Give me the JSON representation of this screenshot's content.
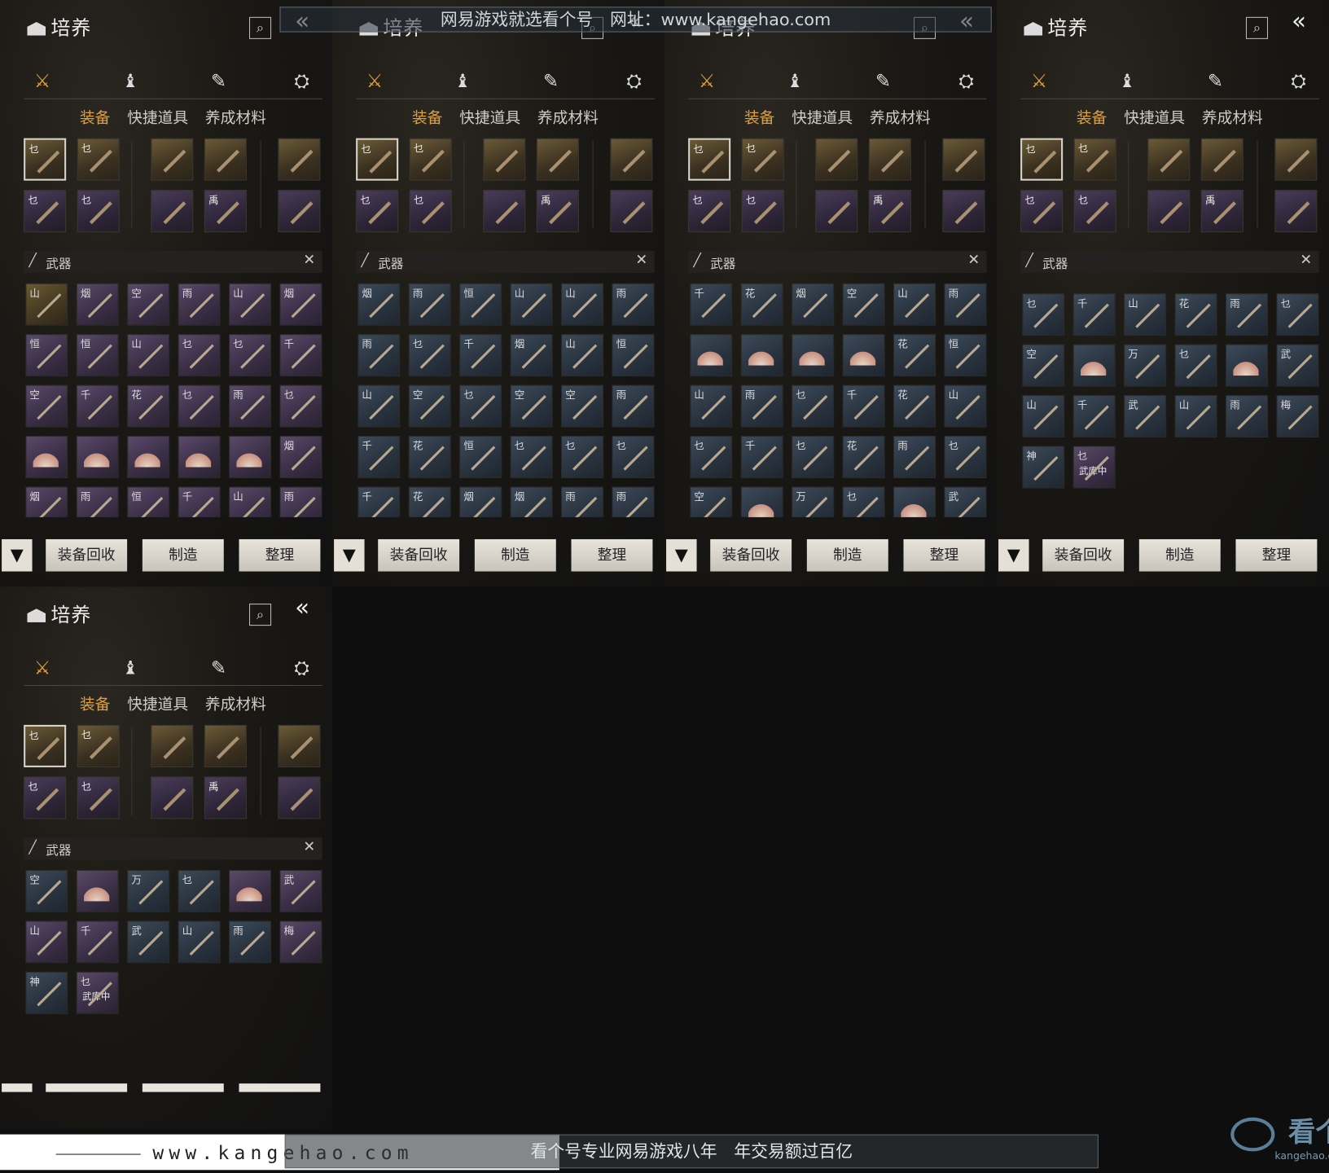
{
  "panel": {
    "title": "培养",
    "search_icon": "⌕",
    "collapse_icon": "«",
    "cat_icons": [
      "⚔",
      "♝",
      "✎",
      "⛭"
    ],
    "subtabs": [
      "装备",
      "快捷道具",
      "养成材料"
    ],
    "filter_label": "武器",
    "filter_close": "✕",
    "buttons": [
      "装备回收",
      "制造",
      "整理"
    ],
    "filter_icon": "▼",
    "equip_marks": [
      "乜",
      "乜",
      "",
      "",
      "",
      "乜",
      "乜",
      "",
      "禹",
      ""
    ],
    "in_armory": "武库中"
  },
  "watermark": {
    "top": "网易游戏就选看个号　网址：www.kangehao.com",
    "url": "www.kangehao.com",
    "band": "看个号专业网易游戏八年　年交易额过百亿",
    "logo": "看个号",
    "logo_sub": "kangehao.com"
  },
  "grids": [
    [
      [
        "山",
        "g"
      ],
      [
        "烟",
        "p"
      ],
      [
        "空",
        "p"
      ],
      [
        "雨",
        "p"
      ],
      [
        "山",
        "p"
      ],
      [
        "烟",
        "p"
      ],
      [
        "恒",
        "p"
      ],
      [
        "恒",
        "p"
      ],
      [
        "山",
        "p"
      ],
      [
        "乜",
        "p"
      ],
      [
        "乜",
        "p"
      ],
      [
        "千",
        "p"
      ],
      [
        "空",
        "p"
      ],
      [
        "千",
        "p"
      ],
      [
        "花",
        "p"
      ],
      [
        "乜",
        "p"
      ],
      [
        "雨",
        "p"
      ],
      [
        "乜",
        "p"
      ],
      [
        "",
        "p fan"
      ],
      [
        "",
        "p fan"
      ],
      [
        "",
        "p fan"
      ],
      [
        "",
        "p fan"
      ],
      [
        "",
        "p fan"
      ],
      [
        "烟",
        "p"
      ],
      [
        "烟",
        "p"
      ],
      [
        "雨",
        "p"
      ],
      [
        "恒",
        "p"
      ],
      [
        "千",
        "p"
      ],
      [
        "山",
        "p"
      ],
      [
        "雨",
        "p"
      ]
    ],
    [
      [
        "烟",
        "b"
      ],
      [
        "雨",
        "b"
      ],
      [
        "恒",
        "b"
      ],
      [
        "山",
        "b"
      ],
      [
        "山",
        "b"
      ],
      [
        "雨",
        "b"
      ],
      [
        "雨",
        "b"
      ],
      [
        "乜",
        "b"
      ],
      [
        "千",
        "b"
      ],
      [
        "烟",
        "b"
      ],
      [
        "山",
        "b"
      ],
      [
        "恒",
        "b"
      ],
      [
        "山",
        "b"
      ],
      [
        "空",
        "b"
      ],
      [
        "乜",
        "b"
      ],
      [
        "空",
        "b"
      ],
      [
        "空",
        "b"
      ],
      [
        "雨",
        "b"
      ],
      [
        "千",
        "b"
      ],
      [
        "花",
        "b"
      ],
      [
        "恒",
        "b"
      ],
      [
        "乜",
        "b"
      ],
      [
        "乜",
        "b"
      ],
      [
        "乜",
        "b"
      ],
      [
        "千",
        "b"
      ],
      [
        "花",
        "b"
      ],
      [
        "烟",
        "b"
      ],
      [
        "烟",
        "b"
      ],
      [
        "雨",
        "b"
      ],
      [
        "雨",
        "b"
      ]
    ],
    [
      [
        "千",
        "b"
      ],
      [
        "花",
        "b"
      ],
      [
        "烟",
        "b"
      ],
      [
        "空",
        "b"
      ],
      [
        "山",
        "b"
      ],
      [
        "雨",
        "b"
      ],
      [
        "",
        "b fan"
      ],
      [
        "",
        "b fan"
      ],
      [
        "",
        "b fan"
      ],
      [
        "",
        "b fan"
      ],
      [
        "花",
        "b"
      ],
      [
        "恒",
        "b"
      ],
      [
        "山",
        "b"
      ],
      [
        "雨",
        "b"
      ],
      [
        "乜",
        "b"
      ],
      [
        "千",
        "b"
      ],
      [
        "花",
        "b"
      ],
      [
        "山",
        "b"
      ],
      [
        "乜",
        "b"
      ],
      [
        "千",
        "b"
      ],
      [
        "乜",
        "b"
      ],
      [
        "花",
        "b"
      ],
      [
        "雨",
        "b"
      ],
      [
        "乜",
        "b"
      ],
      [
        "空",
        "b"
      ],
      [
        "",
        "b fan"
      ],
      [
        "万",
        "b"
      ],
      [
        "乜",
        "b"
      ],
      [
        "",
        "b fan"
      ],
      [
        "武",
        "b"
      ]
    ],
    [
      [
        "乜",
        "b"
      ],
      [
        "千",
        "b"
      ],
      [
        "山",
        "b"
      ],
      [
        "花",
        "b"
      ],
      [
        "雨",
        "b"
      ],
      [
        "乜",
        "b"
      ],
      [
        "空",
        "b"
      ],
      [
        "",
        "b fan"
      ],
      [
        "万",
        "b"
      ],
      [
        "乜",
        "b"
      ],
      [
        "",
        "b fan"
      ],
      [
        "武",
        "b"
      ],
      [
        "山",
        "b"
      ],
      [
        "千",
        "b"
      ],
      [
        "武",
        "b"
      ],
      [
        "山",
        "b"
      ],
      [
        "雨",
        "b"
      ],
      [
        "梅",
        "b"
      ],
      [
        "神",
        "b"
      ],
      [
        "乜",
        "p mark"
      ]
    ],
    [
      [
        "空",
        "b"
      ],
      [
        "",
        "p fan"
      ],
      [
        "万",
        "b"
      ],
      [
        "乜",
        "b"
      ],
      [
        "",
        "p fan"
      ],
      [
        "武",
        "p"
      ],
      [
        "山",
        "p"
      ],
      [
        "千",
        "p"
      ],
      [
        "武",
        "b"
      ],
      [
        "山",
        "b"
      ],
      [
        "雨",
        "b"
      ],
      [
        "梅",
        "p"
      ],
      [
        "神",
        "b"
      ],
      [
        "乜",
        "p mark"
      ]
    ]
  ]
}
